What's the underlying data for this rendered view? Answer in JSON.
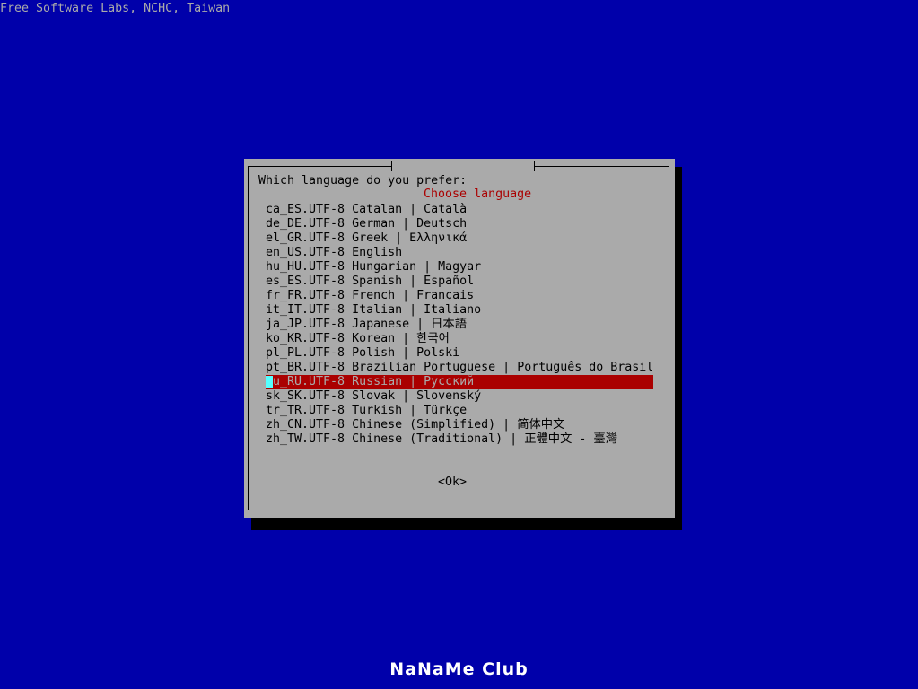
{
  "header": {
    "text": "Free Software Labs, NCHC, Taiwan"
  },
  "dialog": {
    "title": "Choose language",
    "prompt": "Which language do you prefer:",
    "selected_index": 12,
    "items": [
      "ca_ES.UTF-8 Catalan | Català",
      "de_DE.UTF-8 German | Deutsch",
      "el_GR.UTF-8 Greek | Ελληνικά",
      "en_US.UTF-8 English",
      "hu_HU.UTF-8 Hungarian | Magyar",
      "es_ES.UTF-8 Spanish | Español",
      "fr_FR.UTF-8 French | Français",
      "it_IT.UTF-8 Italian | Italiano",
      "ja_JP.UTF-8 Japanese | 日本語",
      "ko_KR.UTF-8 Korean | 한국어",
      "pl_PL.UTF-8 Polish | Polski",
      "pt_BR.UTF-8 Brazilian Portuguese | Português do Brasil",
      "ru_RU.UTF-8 Russian | Русский",
      "sk_SK.UTF-8 Slovak | Slovenský",
      "tr_TR.UTF-8 Turkish | Türkçe",
      "zh_CN.UTF-8 Chinese (Simplified) | 简体中文",
      "zh_TW.UTF-8 Chinese (Traditional) | 正體中文 - 臺灣"
    ],
    "ok_label": "<Ok>"
  },
  "footer": {
    "logo_text": "NaNaMe Club"
  },
  "colors": {
    "background": "#0000aa",
    "dialog_bg": "#aaaaaa",
    "title": "#aa0000",
    "selection_bg": "#aa0000",
    "cursor": "#55ffff"
  }
}
